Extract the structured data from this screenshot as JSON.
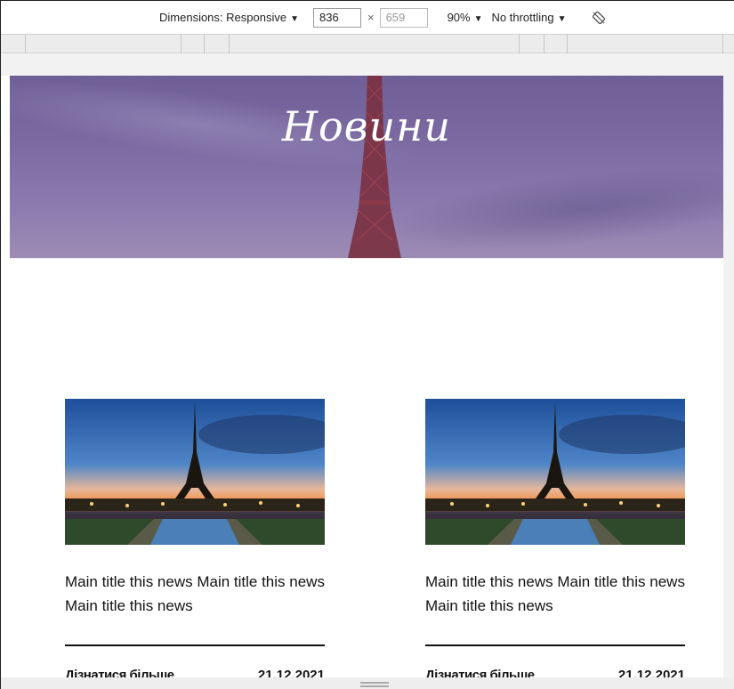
{
  "devtools": {
    "dimensions_label": "Dimensions: Responsive",
    "dropdown_arrow": "▼",
    "width_value": "836",
    "times": "×",
    "height_value": "659",
    "zoom": "90%",
    "throttling": "No throttling",
    "rotate_icon": "rotate-icon"
  },
  "hero": {
    "title": "Новини"
  },
  "news": [
    {
      "title": "Main title this news Main title this news Main title this news",
      "link": "Дізнатися більше",
      "date": "21.12.2021"
    },
    {
      "title": "Main title this news Main title this news Main title this news",
      "link": "Дізнатися більше",
      "date": "21.12.2021"
    }
  ]
}
